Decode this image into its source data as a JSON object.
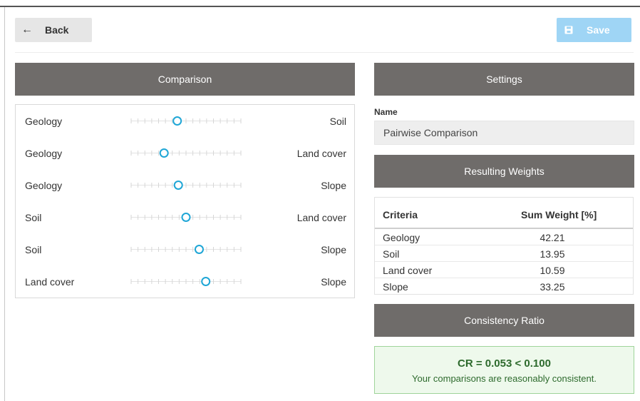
{
  "toolbar": {
    "back_label": "Back",
    "save_label": "Save",
    "back_icon": "arrow-left-icon",
    "save_icon": "floppy-disk-icon",
    "save_color": "#9fd5f5"
  },
  "comparison": {
    "header": "Comparison",
    "rows": [
      {
        "left": "Geology",
        "right": "Soil",
        "value": 0.42
      },
      {
        "left": "Geology",
        "right": "Land cover",
        "value": 0.3
      },
      {
        "left": "Geology",
        "right": "Slope",
        "value": 0.43
      },
      {
        "left": "Soil",
        "right": "Land cover",
        "value": 0.5
      },
      {
        "left": "Soil",
        "right": "Slope",
        "value": 0.62
      },
      {
        "left": "Land cover",
        "right": "Slope",
        "value": 0.68
      }
    ],
    "slider_color": "#1fa6d6"
  },
  "settings": {
    "header": "Settings",
    "name_label": "Name",
    "name_value": "Pairwise Comparison"
  },
  "weights": {
    "header": "Resulting Weights",
    "col_criteria": "Criteria",
    "col_weight": "Sum Weight [%]",
    "rows": [
      {
        "criteria": "Geology",
        "weight": "42.21"
      },
      {
        "criteria": "Soil",
        "weight": "13.95"
      },
      {
        "criteria": "Land cover",
        "weight": "10.59"
      },
      {
        "criteria": "Slope",
        "weight": "33.25"
      }
    ]
  },
  "consistency": {
    "header": "Consistency Ratio",
    "result": "CR = 0.053 < 0.100",
    "message": "Your comparisons are reasonably consistent."
  },
  "colors": {
    "header_bg": "#6f6c6a",
    "cr_text": "#2d6a2d"
  }
}
